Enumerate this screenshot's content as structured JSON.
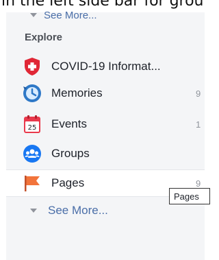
{
  "top_caption": "in the left side bar for groups",
  "sidebar": {
    "see_more_top": "See More...",
    "section_title": "Explore",
    "items": [
      {
        "label": "COVID-19 Informat...",
        "count": "",
        "icon": "covid-shield-icon"
      },
      {
        "label": "Memories",
        "count": "9",
        "icon": "memories-clock-icon"
      },
      {
        "label": "Events",
        "count": "1",
        "icon": "calendar-icon"
      },
      {
        "label": "Groups",
        "count": "",
        "icon": "groups-icon"
      },
      {
        "label": "Pages",
        "count": "9",
        "icon": "flag-icon"
      }
    ],
    "see_more_bottom": "See More..."
  },
  "tooltip": {
    "text": "Pages"
  },
  "calendar_day": "25",
  "colors": {
    "link": "#4a6ea8",
    "covid": "#e02736",
    "memories": "#2e78c7",
    "events": "#e9394c",
    "groups": "#1877f2",
    "pages": "#f2743b"
  }
}
